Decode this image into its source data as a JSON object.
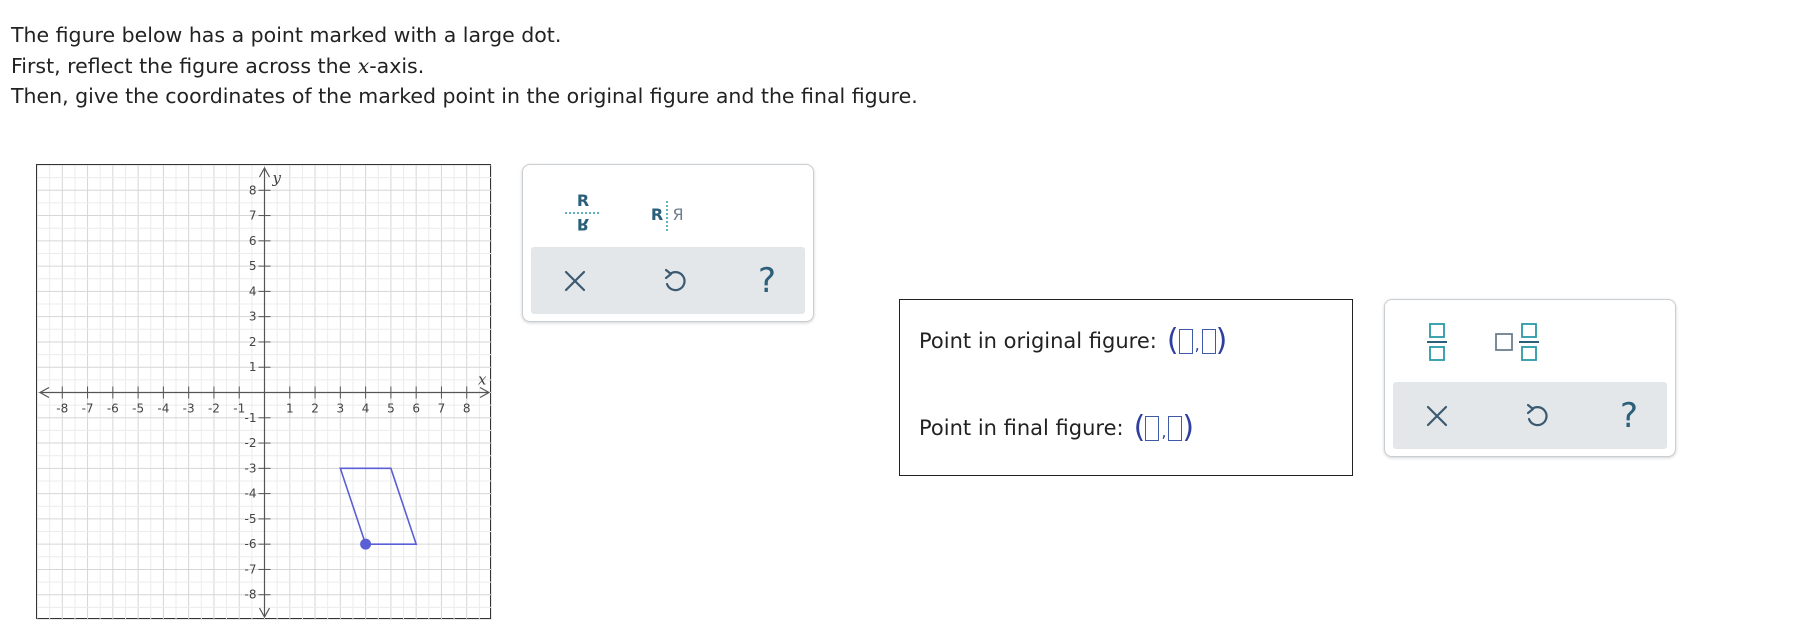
{
  "prompt": {
    "line1": "The figure below has a point marked with a large dot.",
    "line2_before": "First, reflect the figure across the ",
    "line2_var": "x",
    "line2_after": "-axis.",
    "line3": "Then, give the coordinates of the marked point in the original figure and the final figure."
  },
  "graph": {
    "x_axis_label": "x",
    "y_axis_label": "y",
    "x_ticks": [
      "-8",
      "-7",
      "-6",
      "-5",
      "-4",
      "-3",
      "-2",
      "-1",
      "1",
      "2",
      "3",
      "4",
      "5",
      "6",
      "7",
      "8"
    ],
    "y_ticks": [
      "8",
      "7",
      "6",
      "5",
      "4",
      "3",
      "2",
      "1",
      "-1",
      "-2",
      "-3",
      "-4",
      "-5",
      "-6",
      "-7",
      "-8"
    ],
    "x_range": [
      -9,
      9
    ],
    "y_range": [
      -9,
      9
    ],
    "shape_color": "#5b5fd6",
    "figure_vertices": [
      [
        3,
        -3
      ],
      [
        5,
        -3
      ],
      [
        6,
        -6
      ],
      [
        4,
        -6
      ]
    ],
    "marked_point": [
      4,
      -6
    ]
  },
  "toolbar1": {
    "reflect_vertical_glyph_top": "R",
    "reflect_vertical_glyph_bottom": "R",
    "reflect_horizontal_glyph_left": "R",
    "reflect_horizontal_glyph_right": "Я",
    "help_label": "?",
    "icons": [
      "reflect-horizontal-line-icon",
      "reflect-vertical-line-icon",
      "close-icon",
      "undo-icon",
      "help-icon"
    ]
  },
  "answers": {
    "original_label": "Point in original figure:",
    "final_label": "Point in final figure:",
    "paren_open": "(",
    "paren_close": ")",
    "comma": ","
  },
  "toolbar2": {
    "help_label": "?",
    "icons": [
      "fraction-icon",
      "mixed-number-icon",
      "close-icon",
      "undo-icon",
      "help-icon"
    ]
  },
  "colors": {
    "accent": "#2a9aa8",
    "toolbar_action_bg": "#e3e7ea",
    "answer_slot": "#3f5aa8"
  }
}
